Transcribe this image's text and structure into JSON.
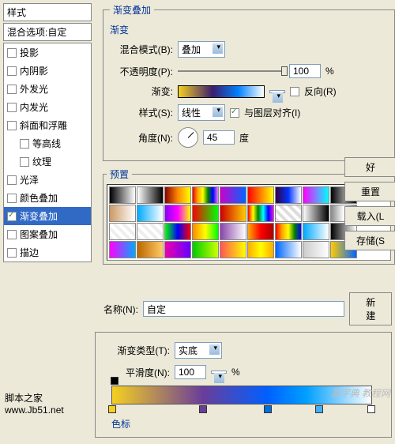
{
  "sidebar": {
    "title": "样式",
    "blend_option": "混合选项:自定",
    "items": [
      {
        "label": "投影",
        "checked": false,
        "indent": false
      },
      {
        "label": "内阴影",
        "checked": false,
        "indent": false
      },
      {
        "label": "外发光",
        "checked": false,
        "indent": false
      },
      {
        "label": "内发光",
        "checked": false,
        "indent": false
      },
      {
        "label": "斜面和浮雕",
        "checked": false,
        "indent": false
      },
      {
        "label": "等高线",
        "checked": false,
        "indent": true
      },
      {
        "label": "纹理",
        "checked": false,
        "indent": true
      },
      {
        "label": "光泽",
        "checked": false,
        "indent": false
      },
      {
        "label": "颜色叠加",
        "checked": false,
        "indent": false
      },
      {
        "label": "渐变叠加",
        "checked": true,
        "indent": false,
        "active": true
      },
      {
        "label": "图案叠加",
        "checked": false,
        "indent": false
      },
      {
        "label": "描边",
        "checked": false,
        "indent": false
      }
    ]
  },
  "overlay": {
    "group_title": "渐变叠加",
    "subgroup": "渐变",
    "blend_label": "混合模式(B):",
    "blend_value": "叠加",
    "opacity_label": "不透明度(P):",
    "opacity_value": "100",
    "opacity_unit": "%",
    "gradient_label": "渐变:",
    "reverse_label": "反向(R)",
    "style_label": "样式(S):",
    "style_value": "线性",
    "align_label": "与图层对齐(I)",
    "angle_label": "角度(N):",
    "angle_value": "45",
    "angle_unit": "度"
  },
  "presets": {
    "title": "预置",
    "swatches": [
      "linear-gradient(90deg,#000,#fff)",
      "linear-gradient(90deg,#fff,#000)",
      "linear-gradient(90deg,#800,#f80,#ff0)",
      "linear-gradient(90deg,red,orange,yellow,green,blue,violet)",
      "linear-gradient(90deg,#c0c,#06f)",
      "linear-gradient(90deg,#f00,#ff0)",
      "linear-gradient(90deg,#304,#03f,#fff)",
      "linear-gradient(90deg,#f0f,#0ff)",
      "linear-gradient(90deg,#000,#888,#000)",
      "linear-gradient(90deg,#c96,#fff)",
      "linear-gradient(90deg,#0af,#fff)",
      "linear-gradient(90deg,#80f,#f0f,#ff0)",
      "linear-gradient(90deg,#f00,#0f0)",
      "linear-gradient(90deg,#c00,#fc0)",
      "linear-gradient(90deg,red,yellow,green,cyan,blue,magenta)",
      "repeating-linear-gradient(45deg,#ddd 0 4px,#fff 4px 8px)",
      "linear-gradient(90deg,#fff,#000)",
      "linear-gradient(90deg,#888,#fff,#888)",
      "repeating-linear-gradient(45deg,#eee 0 4px,#fff 4px 8px)",
      "repeating-linear-gradient(45deg,#eee 0 4px,#fff 4px 8px)",
      "linear-gradient(90deg,#0f0,#00f,#f00)",
      "linear-gradient(90deg,#f80,#ff0,#0f0)",
      "linear-gradient(90deg,#84a,#fff)",
      "linear-gradient(90deg,#fa0,#f00,#a00)",
      "linear-gradient(90deg,red,orange,yellow,green,blue)",
      "linear-gradient(90deg,#0af,#fff)",
      "linear-gradient(90deg,#000,#fff)",
      "linear-gradient(90deg,#f0f,#0af)",
      "linear-gradient(90deg,#b60,#fc6)",
      "linear-gradient(90deg,#e0a,#60f)",
      "linear-gradient(90deg,#0c0,#cf0)",
      "linear-gradient(90deg,#f55,#ff0)",
      "linear-gradient(90deg,#fa0,#ff0,#fa0)",
      "linear-gradient(90deg,#06f,#fff)",
      "linear-gradient(90deg,#ccc,#fff)",
      "linear-gradient(90deg,#fc0,#06f)"
    ]
  },
  "buttons": {
    "ok": "好",
    "reset": "重置",
    "load": "载入(L",
    "save": "存储(S",
    "new": "新建"
  },
  "editor": {
    "name_label": "名称(N):",
    "name_value": "自定",
    "type_label": "渐变类型(T):",
    "type_value": "实底",
    "smooth_label": "平滑度(N):",
    "smooth_value": "100",
    "smooth_unit": "%",
    "stops_title": "色标",
    "color_stops": [
      {
        "pos": 0,
        "color": "#f5d020"
      },
      {
        "pos": 35,
        "color": "#6a3d9a"
      },
      {
        "pos": 60,
        "color": "#0070e0"
      },
      {
        "pos": 80,
        "color": "#40b0ff"
      },
      {
        "pos": 100,
        "color": "#ffffff"
      }
    ]
  },
  "footer": {
    "site1": "脚本之家",
    "site2": "www.Jb51.net"
  },
  "watermark": "基字典 教程网"
}
